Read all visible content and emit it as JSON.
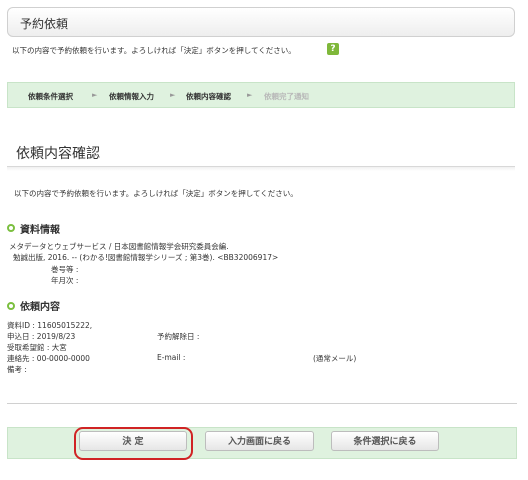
{
  "header": {
    "title": "予約依頼"
  },
  "intro": {
    "text": "以下の内容で予約依頼を行います。よろしければ「決定」ボタンを押してください。",
    "help_icon": "?"
  },
  "steps": [
    {
      "label": "依頼条件選択",
      "active": true
    },
    {
      "label": "依頼情報入力",
      "active": true
    },
    {
      "label": "依頼内容確認",
      "active": true
    },
    {
      "label": "依頼完了通知",
      "active": false
    }
  ],
  "step_arrow": "►",
  "confirm": {
    "title": "依頼内容確認",
    "text": "以下の内容で予約依頼を行います。よろしければ「決定」ボタンを押してください。"
  },
  "material": {
    "heading": "資料情報",
    "line1": "メタデータとウェブサービス / 日本図書館情報学会研究委員会編.",
    "line2": "勉誠出版, 2016. -- (わかる!図書館情報学シリーズ ; 第3巻).  <BB32006917>",
    "vol_label": "巻号等 :",
    "year_label": "年月次 :"
  },
  "request": {
    "heading": "依頼内容",
    "material_id": "資料ID : 11605015222,",
    "date": "申込日 : 2019/8/23",
    "cancel_date": "予約解除日 :",
    "pickup": "受取希望館 : 大宮",
    "contact": "連絡先 : 00-0000-0000",
    "email": "E-mail :",
    "email_type": "(通常メール)",
    "remarks": "備考 :"
  },
  "buttons": {
    "decide": "決 定",
    "back_input": "入力画面に戻る",
    "back_condition": "条件選択に戻る"
  },
  "colors": {
    "accent_green": "#7bbf3f",
    "highlight_red": "#d02424",
    "bar_bg": "#dff2df"
  }
}
